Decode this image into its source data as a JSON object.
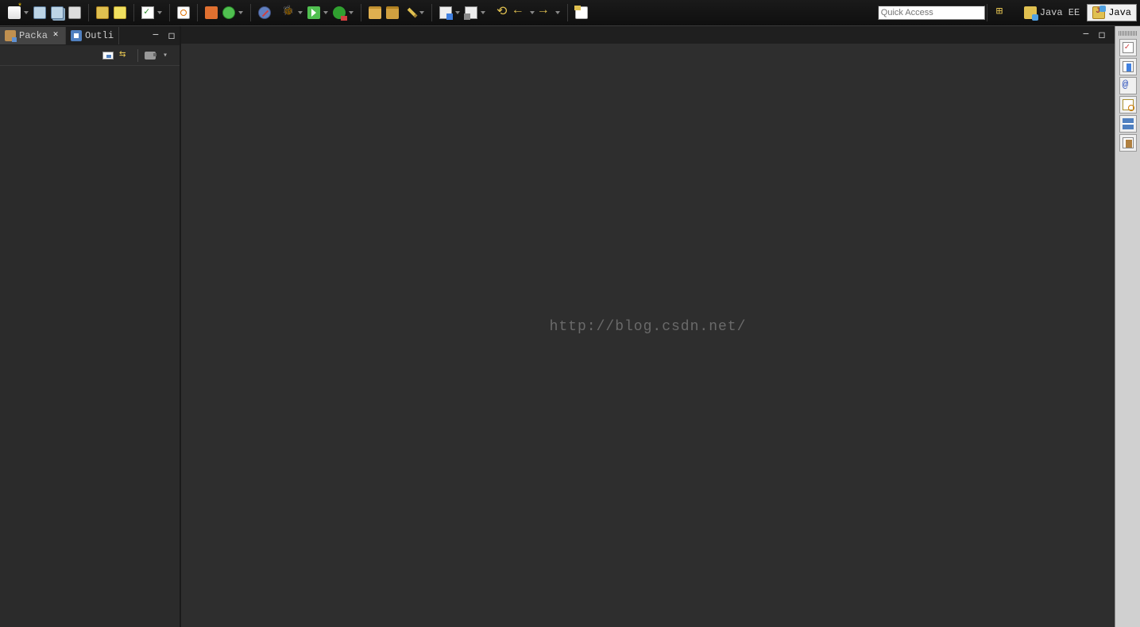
{
  "toolbar": {
    "quick_access_placeholder": "Quick Access",
    "groups": {
      "file": [
        "new",
        "save",
        "save-all",
        "print"
      ],
      "build": [
        "build",
        "help"
      ],
      "annot": [
        "checkbox"
      ],
      "search": [
        "search"
      ],
      "debug": [
        "debug-config",
        "run-config"
      ],
      "breakpoints": [
        "skip-breakpoints"
      ],
      "launch": [
        "debug",
        "run",
        "external-run"
      ],
      "open": [
        "open-folder",
        "open-project",
        "highlight"
      ],
      "tags": [
        "tag-next",
        "tag-prev"
      ],
      "nav": [
        "undo-nav",
        "back",
        "forward"
      ],
      "cheatsheet": [
        "cheat-sheets"
      ]
    }
  },
  "perspectives": {
    "open_label": "",
    "items": [
      {
        "id": "java-ee",
        "label": "Java EE",
        "active": false
      },
      {
        "id": "java",
        "label": "Java",
        "active": true
      }
    ]
  },
  "side_views": {
    "tabs": [
      {
        "id": "package-explorer",
        "label": "Packa",
        "active": true,
        "closable": true
      },
      {
        "id": "outline",
        "label": "Outli",
        "active": false,
        "closable": false
      }
    ],
    "view_toolbar": [
      "collapse-all",
      "link-with-editor",
      "focus-task",
      "view-menu"
    ]
  },
  "editor": {
    "watermark": "http://blog.csdn.net/"
  },
  "right_strip": {
    "views": [
      {
        "id": "tasks",
        "icon": "task"
      },
      {
        "id": "bookmarks",
        "icon": "bookmark"
      },
      {
        "id": "javadoc",
        "icon": "at"
      },
      {
        "id": "servers",
        "icon": "servers"
      },
      {
        "id": "properties",
        "icon": "props"
      },
      {
        "id": "snippets",
        "icon": "snippets"
      }
    ]
  }
}
